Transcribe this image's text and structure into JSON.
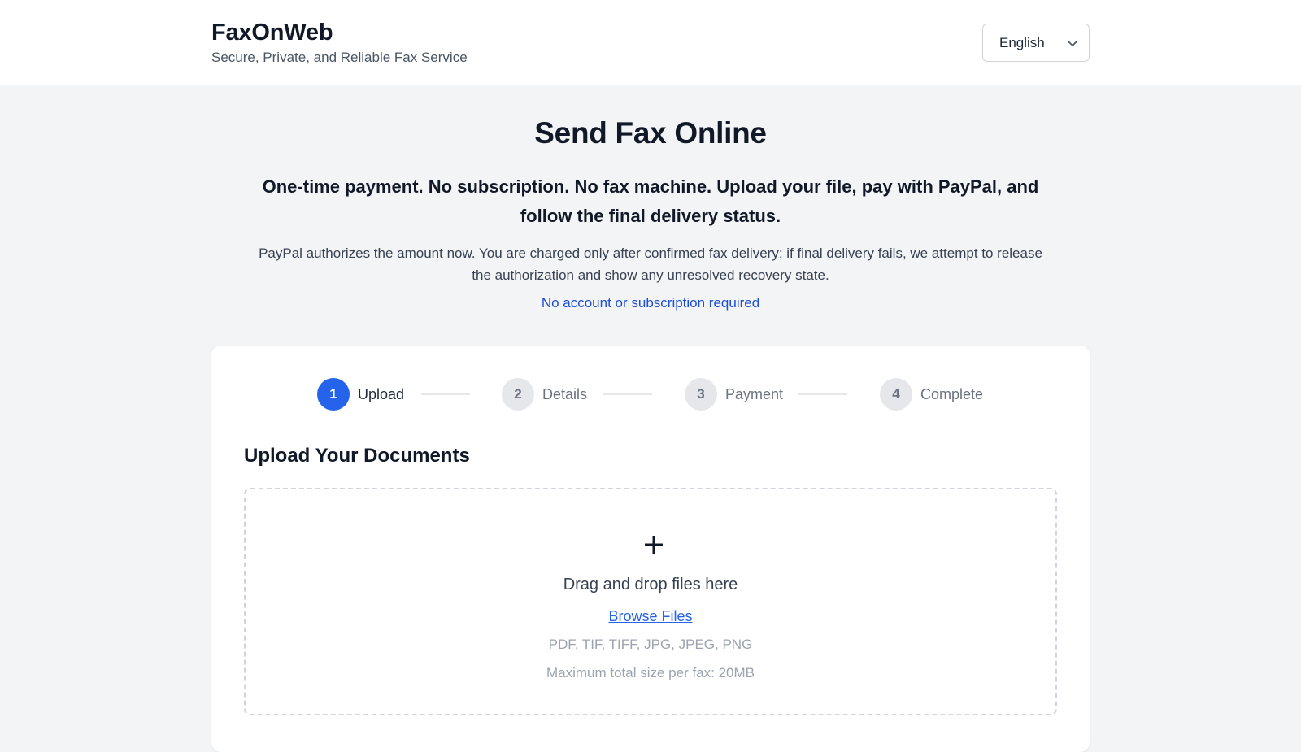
{
  "header": {
    "brand_name": "FaxOnWeb",
    "tagline": "Secure, Private, and Reliable Fax Service",
    "language": {
      "selected": "English",
      "icon": "chevron-down-icon"
    }
  },
  "hero": {
    "title": "Send Fax Online",
    "lead": "One-time payment. No subscription. No fax machine. Upload your file, pay with PayPal, and follow the final delivery status.",
    "note": "PayPal authorizes the amount now. You are charged only after confirmed fax delivery; if final delivery fails, we attempt to release the authorization and show any unresolved recovery state.",
    "link": "No account or subscription required"
  },
  "stepper": {
    "steps": [
      {
        "number": "1",
        "label": "Upload",
        "state": "active"
      },
      {
        "number": "2",
        "label": "Details",
        "state": "inactive"
      },
      {
        "number": "3",
        "label": "Payment",
        "state": "inactive"
      },
      {
        "number": "4",
        "label": "Complete",
        "state": "inactive"
      }
    ]
  },
  "upload": {
    "title": "Upload Your Documents",
    "icon": "plus-icon",
    "drop_text": "Drag and drop files here",
    "browse_label": "Browse Files",
    "formats": "PDF, TIF, TIFF, JPG, JPEG, PNG",
    "max_size": "Maximum total size per fax: 20MB"
  },
  "colors": {
    "accent": "#2563eb",
    "link": "#1d4ed8",
    "background": "#f3f4f6",
    "inactive_step": "#e5e7eb"
  }
}
